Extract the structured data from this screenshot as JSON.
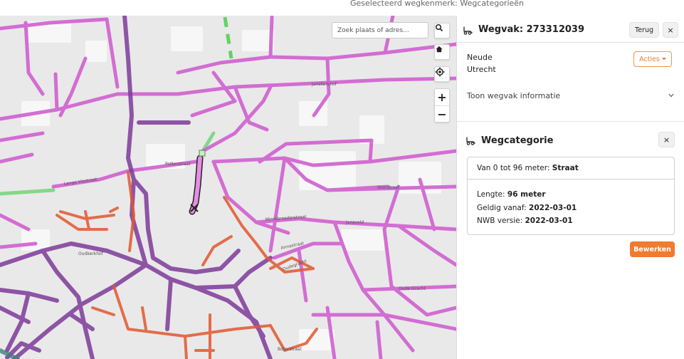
{
  "topbar": {
    "selected_feature": "Geselecteerd wegkenmerk: Wegcategorieën"
  },
  "map": {
    "search_placeholder": "Zoek plaats of adres...",
    "zoom_in": "+",
    "zoom_out": "−",
    "street_labels": [
      "Potterstraat",
      "Lange Viestraat",
      "Oudkerkhof",
      "Minrebroederstraat",
      "Annastraat",
      "Oudegracht",
      "Boterstraat",
      "Janskerkhof",
      "Jansveld",
      "Voorstraat",
      "Oude Gracht"
    ],
    "colors": {
      "local": "#d060d0",
      "main": "#7d3b9a",
      "regional": "#e3572f",
      "other": "#62d265",
      "teal": "#3f7f7c",
      "selected": "#e68ee5",
      "background": "#e9e9e9"
    }
  },
  "panel": {
    "header": {
      "title": "Wegvak: 273312039",
      "back_label": "Terug",
      "close_label": "×"
    },
    "info": {
      "street": "Neude",
      "city": "Utrecht",
      "actions_label": "Acties",
      "toggle_label": "Toon wegvak informatie"
    },
    "category": {
      "title": "Wegcategorie",
      "close_label": "×",
      "range_label": "Van 0 tot 96 meter:",
      "range_value": "Straat",
      "length_label": "Lengte:",
      "length_value": "96 meter",
      "valid_label": "Geldig vanaf:",
      "valid_value": "2022-03-01",
      "nwb_label": "NWB versie:",
      "nwb_value": "2022-03-01",
      "edit_label": "Bewerken"
    },
    "accent_color": "#f07a2e"
  }
}
